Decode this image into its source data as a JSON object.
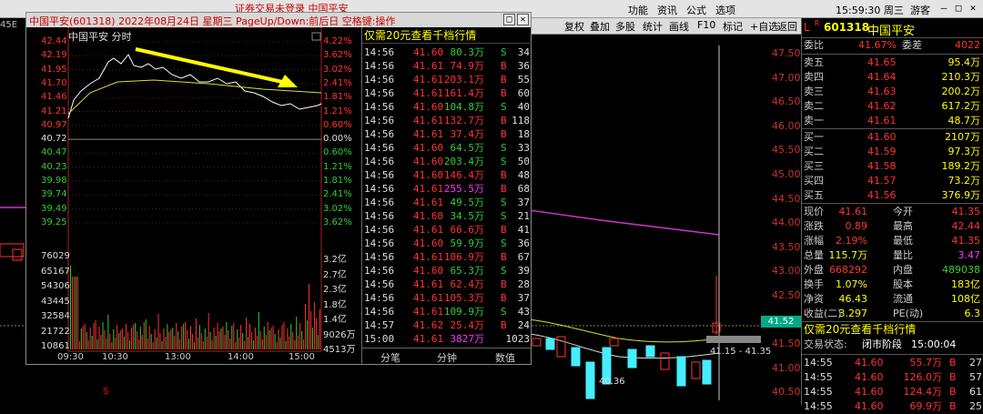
{
  "topbar": {
    "notice": "证券交易未登录 中国平安",
    "menu": [
      "功能",
      "资讯",
      "公式",
      "选项"
    ],
    "clock": "15:59:30 周三",
    "user": "游客",
    "win": [
      "—",
      "□",
      "✕"
    ]
  },
  "toolbar": {
    "items": [
      "复权",
      "叠加",
      "多股",
      "统计",
      "画线",
      "F10",
      "标记",
      "+自选",
      "返回"
    ]
  },
  "bg": {
    "code": "45E",
    "ylabels": [
      "47.50",
      "47.00",
      "46.50",
      "46.00",
      "45.50",
      "45.00",
      "44.50",
      "44.00",
      "43.50",
      "43.00",
      "42.50",
      "42.00",
      "41.50",
      "41.00",
      "40.50"
    ],
    "price_tag": "41.52",
    "range": "41.15 - 41.35",
    "low_label": "40.36",
    "marker": "S"
  },
  "popup": {
    "title": "中国平安(601318)  2022年08月24日 星期三  PageUp/Down:前后日  空格键:操作",
    "buttons": [
      "□",
      "✕"
    ],
    "chart_label": "中国平安  分时",
    "price_levels": [
      {
        "p": "42.44",
        "r": "4.22%",
        "c": "#f33"
      },
      {
        "p": "42.19",
        "r": "3.62%",
        "c": "#f33"
      },
      {
        "p": "41.95",
        "r": "3.02%",
        "c": "#f33"
      },
      {
        "p": "41.70",
        "r": "2.41%",
        "c": "#f33"
      },
      {
        "p": "41.46",
        "r": "1.81%",
        "c": "#f33"
      },
      {
        "p": "41.21",
        "r": "1.21%",
        "c": "#f33"
      },
      {
        "p": "40.97",
        "r": "0.60%",
        "c": "#f33"
      },
      {
        "p": "40.72",
        "r": "0.00%",
        "c": "#ddd"
      },
      {
        "p": "40.47",
        "r": "0.60%",
        "c": "#3c3"
      },
      {
        "p": "40.23",
        "r": "1.21%",
        "c": "#3c3"
      },
      {
        "p": "39.98",
        "r": "1.81%",
        "c": "#3c3"
      },
      {
        "p": "39.74",
        "r": "2.41%",
        "c": "#3c3"
      },
      {
        "p": "39.49",
        "r": "3.02%",
        "c": "#3c3"
      },
      {
        "p": "39.25",
        "r": "3.62%",
        "c": "#3c3"
      }
    ],
    "vol_levels": [
      {
        "l": "76029",
        "r": "3.2亿"
      },
      {
        "l": "65167",
        "r": "2.7亿"
      },
      {
        "l": "54306",
        "r": "2.3亿"
      },
      {
        "l": "43445",
        "r": "1.8亿"
      },
      {
        "l": "32584",
        "r": "1.4亿"
      },
      {
        "l": "21722",
        "r": "9026万"
      },
      {
        "l": "10861",
        "r": "4513万"
      }
    ],
    "x_labels": [
      "09:30",
      "10:30",
      "13:00",
      "14:00",
      "15:00"
    ],
    "ticks_header": "仅需20元查看千档行情",
    "ticks": [
      {
        "t": "14:56",
        "p": "41.60",
        "v": "80.3万",
        "s": "S",
        "n": "34"
      },
      {
        "t": "14:56",
        "p": "41.61",
        "v": "74.9万",
        "s": "B",
        "n": "36"
      },
      {
        "t": "14:56",
        "p": "41.61",
        "v": "203.1万",
        "s": "B",
        "n": "55"
      },
      {
        "t": "14:56",
        "p": "41.61",
        "v": "161.4万",
        "s": "B",
        "n": "60"
      },
      {
        "t": "14:56",
        "p": "41.60",
        "v": "104.8万",
        "s": "S",
        "n": "40"
      },
      {
        "t": "14:56",
        "p": "41.61",
        "v": "132.7万",
        "s": "B",
        "n": "118"
      },
      {
        "t": "14:56",
        "p": "41.61",
        "v": "37.4万",
        "s": "B",
        "n": "18"
      },
      {
        "t": "14:56",
        "p": "41.60",
        "v": "64.5万",
        "s": "S",
        "n": "33"
      },
      {
        "t": "14:56",
        "p": "41.60",
        "v": "203.4万",
        "s": "S",
        "n": "50"
      },
      {
        "t": "14:56",
        "p": "41.60",
        "v": "146.4万",
        "s": "B",
        "n": "48"
      },
      {
        "t": "14:56",
        "p": "41.61",
        "v": "255.5万",
        "s": "B",
        "n": "68",
        "hl": true
      },
      {
        "t": "14:56",
        "p": "41.61",
        "v": "49.5万",
        "s": "S",
        "n": "37"
      },
      {
        "t": "14:56",
        "p": "41.60",
        "v": "34.5万",
        "s": "S",
        "n": "21"
      },
      {
        "t": "14:56",
        "p": "41.61",
        "v": "66.6万",
        "s": "B",
        "n": "41"
      },
      {
        "t": "14:56",
        "p": "41.60",
        "v": "59.9万",
        "s": "S",
        "n": "36"
      },
      {
        "t": "14:56",
        "p": "41.61",
        "v": "106.9万",
        "s": "B",
        "n": "67"
      },
      {
        "t": "14:56",
        "p": "41.60",
        "v": "65.3万",
        "s": "S",
        "n": "39"
      },
      {
        "t": "14:56",
        "p": "41.61",
        "v": "62.4万",
        "s": "B",
        "n": "28"
      },
      {
        "t": "14:56",
        "p": "41.61",
        "v": "105.3万",
        "s": "B",
        "n": "37"
      },
      {
        "t": "14:56",
        "p": "41.61",
        "v": "109.9万",
        "s": "S",
        "n": "43"
      },
      {
        "t": "14:57",
        "p": "41.62",
        "v": "25.4万",
        "s": "B",
        "n": "24"
      },
      {
        "t": "15:00",
        "p": "41.61",
        "v": "3827万",
        "s": "",
        "n": "1023",
        "hl": true
      }
    ],
    "ticks_footer": [
      "分笔",
      "分钟",
      "数值"
    ]
  },
  "right": {
    "l_mark": "L",
    "code_prefix": "R",
    "code": "601318",
    "name": "中国平安",
    "weibi": {
      "label": "委比",
      "value": "41.67%",
      "label2": "委差",
      "value2": "4022"
    },
    "asks": [
      {
        "l": "卖五",
        "p": "41.65",
        "v": "95.4万"
      },
      {
        "l": "卖四",
        "p": "41.64",
        "v": "210.3万"
      },
      {
        "l": "卖三",
        "p": "41.63",
        "v": "200.2万"
      },
      {
        "l": "卖二",
        "p": "41.62",
        "v": "617.2万"
      },
      {
        "l": "卖一",
        "p": "41.61",
        "v": "48.7万"
      }
    ],
    "bids": [
      {
        "l": "买一",
        "p": "41.60",
        "v": "2107万"
      },
      {
        "l": "买二",
        "p": "41.59",
        "v": "97.3万"
      },
      {
        "l": "买三",
        "p": "41.58",
        "v": "189.2万"
      },
      {
        "l": "买四",
        "p": "41.57",
        "v": "73.2万"
      },
      {
        "l": "买五",
        "p": "41.56",
        "v": "376.9万"
      }
    ],
    "stats": [
      {
        "l1": "现价",
        "v1": "41.61",
        "c1": "#f33",
        "l2": "今开",
        "v2": "41.35",
        "c2": "#f33"
      },
      {
        "l1": "涨跌",
        "v1": "0.89",
        "c1": "#f33",
        "l2": "最高",
        "v2": "42.44",
        "c2": "#f33"
      },
      {
        "l1": "涨幅",
        "v1": "2.19%",
        "c1": "#f33",
        "l2": "最低",
        "v2": "41.35",
        "c2": "#f33"
      },
      {
        "l1": "总量",
        "v1": "115.7万",
        "c1": "#ff0",
        "l2": "量比",
        "v2": "3.47",
        "c2": "#f3f"
      },
      {
        "l1": "外盘",
        "v1": "668292",
        "c1": "#f33",
        "l2": "内盘",
        "v2": "489038",
        "c2": "#3c3"
      },
      {
        "l1": "换手",
        "v1": "1.07%",
        "c1": "#ff0",
        "l2": "股本",
        "v2": "183亿",
        "c2": "#ff0"
      },
      {
        "l1": "净资",
        "v1": "46.43",
        "c1": "#ff0",
        "l2": "流通",
        "v2": "108亿",
        "c2": "#ff0"
      },
      {
        "l1": "收益(二)",
        "v1": "3.297",
        "c1": "#ff0",
        "l2": "PE(动)",
        "v2": "6.3",
        "c2": "#ff0"
      }
    ],
    "promo": "仅需20元查看千档行情",
    "status_label": "交易状态:",
    "status": "闭市阶段",
    "status_time": "15:00:04",
    "ticks": [
      {
        "t": "14:55",
        "p": "41.60",
        "v": "55.7万",
        "s": "B",
        "n": "27"
      },
      {
        "t": "14:55",
        "p": "41.60",
        "v": "126.0万",
        "s": "B",
        "n": "57"
      },
      {
        "t": "14:55",
        "p": "41.60",
        "v": "124.4万",
        "s": "B",
        "n": "61"
      },
      {
        "t": "14:55",
        "p": "41.60",
        "v": "69.9万",
        "s": "B",
        "n": "25"
      }
    ]
  },
  "colors": {
    "up": "#ff3333",
    "down": "#33cc33",
    "accent": "#ffff00",
    "bg": "#000000"
  }
}
